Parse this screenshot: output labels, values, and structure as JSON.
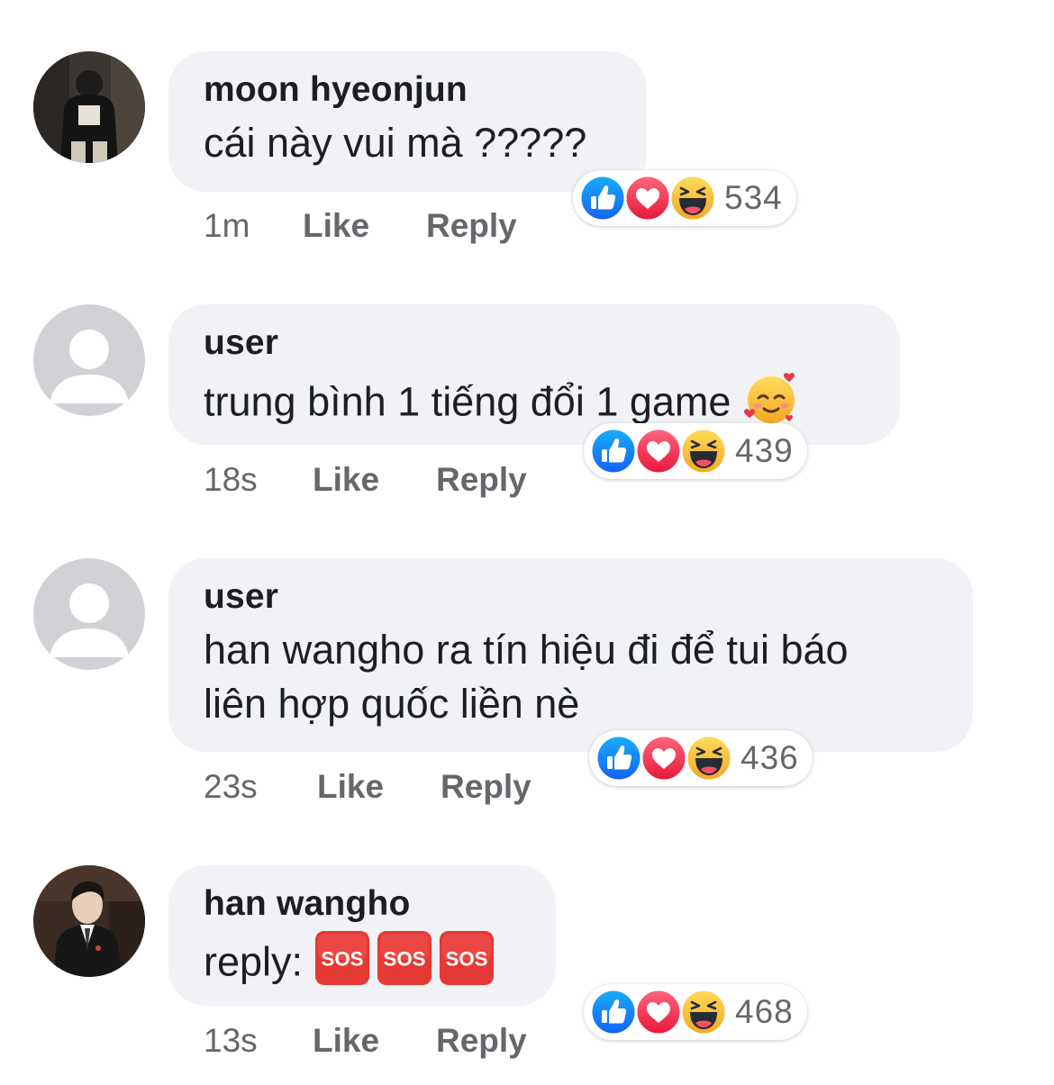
{
  "comments": [
    {
      "author": "moon hyeonjun",
      "text": "cái này vui mà ?????",
      "time": "1m",
      "like_label": "Like",
      "reply_label": "Reply",
      "reaction_count": "534",
      "avatar": "photo-avatar"
    },
    {
      "author": "user",
      "text": "trung bình 1 tiếng đổi 1 game",
      "emoji": "smiling-face-with-hearts-emoji",
      "time": "18s",
      "like_label": "Like",
      "reply_label": "Reply",
      "reaction_count": "439",
      "avatar": "default-avatar"
    },
    {
      "author": "user",
      "text_line1": "han wangho ra tín hiệu đi để tui báo",
      "text_line2": "liên hợp quốc liền nè",
      "time": "23s",
      "like_label": "Like",
      "reply_label": "Reply",
      "reaction_count": "436",
      "avatar": "default-avatar"
    },
    {
      "author": "han wangho",
      "text": "reply:",
      "sos_label": "SOS",
      "time": "13s",
      "like_label": "Like",
      "reply_label": "Reply",
      "reaction_count": "468",
      "avatar": "photo-avatar"
    }
  ],
  "colors": {
    "bubble": "#f0f2f5",
    "meta_text": "#65676b",
    "like_blue": "#1877f2",
    "love_red": "#f33e58",
    "haha_yellow": "#f7b125",
    "sos_red": "#e53935"
  }
}
